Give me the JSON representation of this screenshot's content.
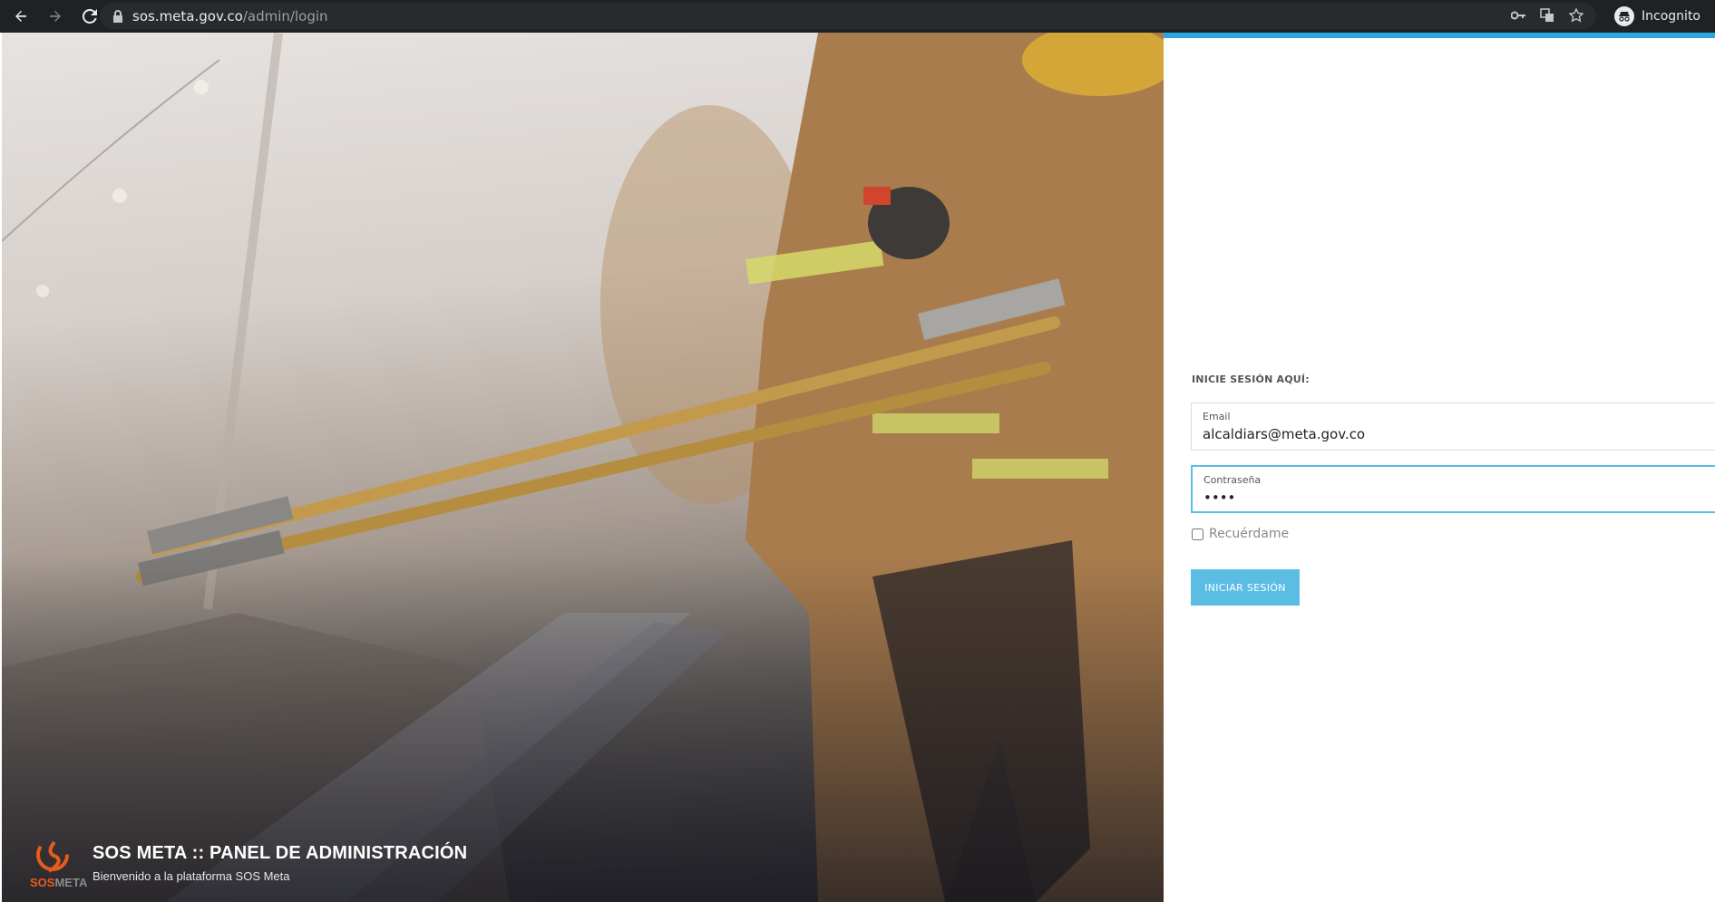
{
  "browser": {
    "url_host": "sos.meta.gov.co",
    "url_path": "/admin/login",
    "profile_label": "Incognito",
    "icons": [
      "back-icon",
      "forward-icon",
      "reload-icon",
      "lock-icon",
      "key-icon",
      "translate-icon",
      "star-icon",
      "incognito-icon"
    ]
  },
  "hero": {
    "title": "SOS META :: PANEL DE ADMINISTRACIÓN",
    "subtitle": "Bienvenido a la plataforma SOS Meta",
    "logo_text_a": "SOS",
    "logo_text_b": "META"
  },
  "login": {
    "heading": "INICIE SESIÓN AQUÍ:",
    "email_label": "Email",
    "email_value": "alcaldiars@meta.gov.co",
    "password_label": "Contraseña",
    "password_value": "••••",
    "remember_label": "Recuérdame",
    "remember_checked": false,
    "submit_label": "INICIAR SESIÓN"
  },
  "colors": {
    "accent": "#5bbde3",
    "topbar": "#29a8e0",
    "logo_orange": "#e85a1d"
  }
}
